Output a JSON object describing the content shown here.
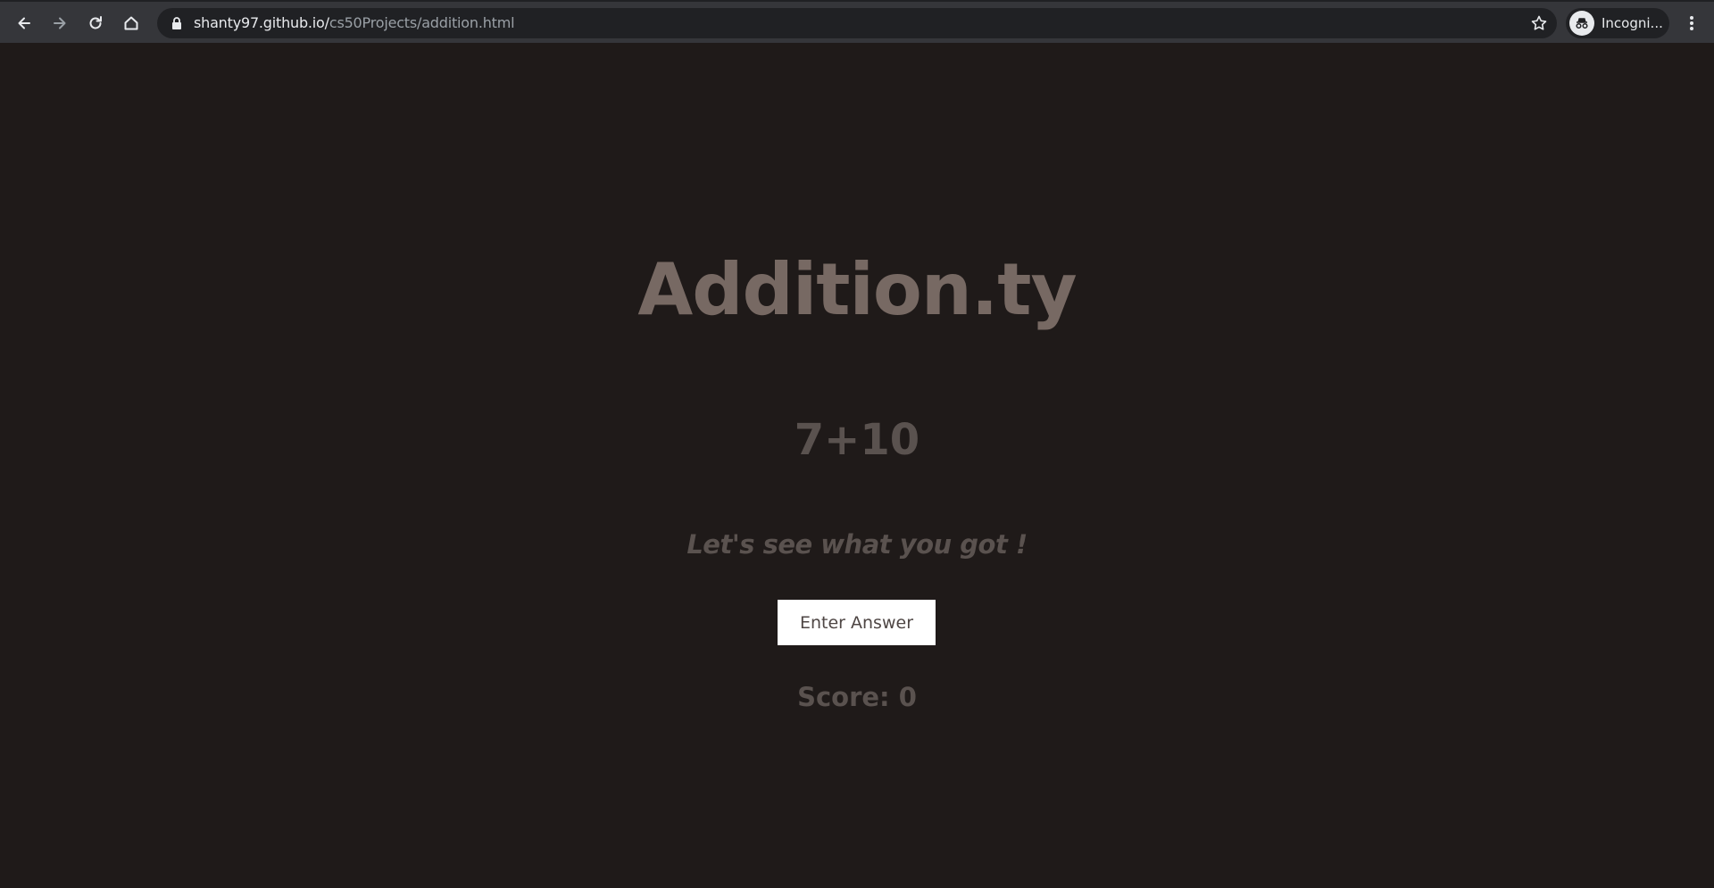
{
  "browser": {
    "url_host": "shanty97.github.io/",
    "url_path": "cs50Projects/addition.html",
    "profile_label": "Incogni...",
    "icons": {
      "back": "back-arrow-icon",
      "forward": "forward-arrow-icon",
      "reload": "reload-icon",
      "home": "home-icon",
      "lock": "lock-icon",
      "star": "star-icon",
      "incognito": "incognito-icon",
      "menu": "kebab-menu-icon"
    }
  },
  "page": {
    "title": "Addition.ty",
    "problem": "7+10",
    "tagline": "Let's see what you got !",
    "answer_button_label": "Enter Answer",
    "score_text": "Score: 0"
  },
  "colors": {
    "background": "#1f1a19",
    "title": "#776963",
    "muted_text": "#5a524f",
    "button_bg": "#ffffff"
  }
}
